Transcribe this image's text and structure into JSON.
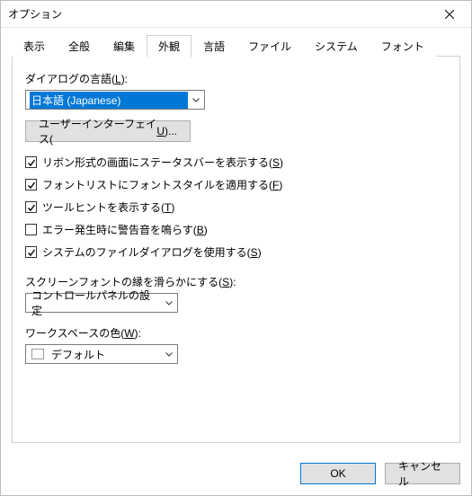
{
  "window": {
    "title": "オプション"
  },
  "tabs": [
    {
      "label": "表示"
    },
    {
      "label": "全般"
    },
    {
      "label": "編集"
    },
    {
      "label": "外観"
    },
    {
      "label": "言語"
    },
    {
      "label": "ファイル"
    },
    {
      "label": "システム"
    },
    {
      "label": "フォント"
    }
  ],
  "appearance": {
    "dialog_language_label_pre": "ダイアログの言語(",
    "dialog_language_hotkey": "L",
    "dialog_language_label_post": "):",
    "dialog_language_value": "日本語 (Japanese)",
    "ui_button_label_pre": "ユーザーインターフェイス(",
    "ui_button_hotkey": "U",
    "ui_button_label_post": ")...",
    "checks": {
      "ribbon_status_pre": "リボン形式の画面にステータスバーを表示する(",
      "ribbon_status_hk": "S",
      "ribbon_status_post": ")",
      "ribbon_status_checked": true,
      "fontlist_pre": "フォントリストにフォントスタイルを適用する(",
      "fontlist_hk": "F",
      "fontlist_post": ")",
      "fontlist_checked": true,
      "tooltip_pre": "ツールヒントを表示する(",
      "tooltip_hk": "T",
      "tooltip_post": ")",
      "tooltip_checked": true,
      "beep_pre": "エラー発生時に警告音を鳴らす(",
      "beep_hk": "B",
      "beep_post": ")",
      "beep_checked": false,
      "sysdlg_pre": "システムのファイルダイアログを使用する(",
      "sysdlg_hk": "S",
      "sysdlg_post": ")",
      "sysdlg_checked": true
    },
    "smooth_label_pre": "スクリーンフォントの縁を滑らかにする(",
    "smooth_hk": "S",
    "smooth_label_post": "):",
    "smooth_value": "コントロールパネルの設定",
    "workspace_label_pre": "ワークスペースの色(",
    "workspace_hk": "W",
    "workspace_label_post": "):",
    "workspace_value": "デフォルト"
  },
  "footer": {
    "ok": "OK",
    "cancel": "キャンセル"
  }
}
